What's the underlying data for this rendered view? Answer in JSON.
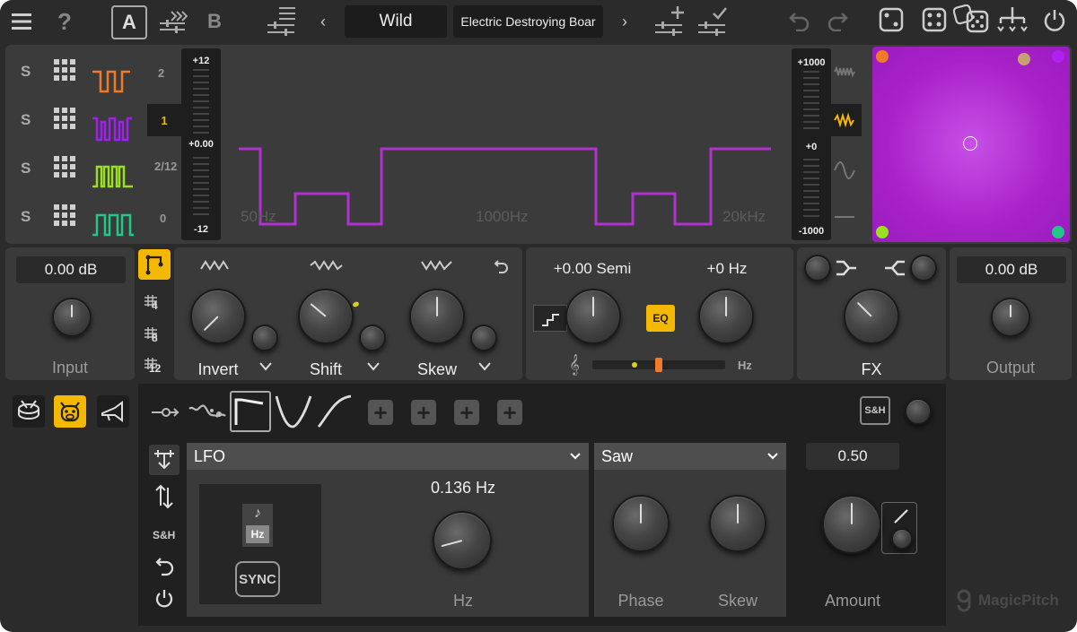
{
  "topbar": {
    "ab_a": "A",
    "ab_b": "B",
    "preset_bank": "Wild",
    "preset_name": "Electric Destroying Boar"
  },
  "osc_rows": {
    "solo_labels": [
      "S",
      "S",
      "S",
      "S"
    ],
    "waveform_colors": [
      "#f07a2a",
      "#a020f0",
      "#9ae020",
      "#22c888"
    ],
    "octave_labels": [
      "2",
      "1",
      "2/12",
      "0"
    ],
    "selected_octave": "1"
  },
  "pitch_meter": {
    "top": "+12",
    "mid": "+0.00",
    "bottom": "-12"
  },
  "display": {
    "freq_labels": [
      "50Hz",
      "1000Hz",
      "20kHz"
    ],
    "wave_color": "#b030d0"
  },
  "mod_meter": {
    "top": "+1000",
    "mid": "+0",
    "bottom": "-1000"
  },
  "xy_pad": {
    "bg": "#a822c8",
    "corner_colors": [
      "#f07a2a",
      "#c8a070",
      "#b020f0",
      "#9ae020",
      "#22c888"
    ]
  },
  "input": {
    "value": "0.00 dB",
    "label": "Input"
  },
  "routing_side": {
    "grid_labels": [
      "4",
      "8",
      "12"
    ]
  },
  "shaper": {
    "knobs": [
      "Invert",
      "Shift",
      "Skew"
    ]
  },
  "pitch": {
    "semi": "+0.00 Semi",
    "hz": "+0 Hz",
    "eq": "EQ",
    "hz_label": "Hz",
    "slider_value": 0.45
  },
  "fx": {
    "label": "FX"
  },
  "output": {
    "value": "0.00 dB",
    "label": "Output"
  },
  "mod_tabs": {
    "sh_label": "S&H"
  },
  "modulator": {
    "source": "LFO",
    "rate": "0.136 Hz",
    "rate_label": "Hz",
    "hz_tag": "Hz",
    "sync": "SYNC",
    "side_sh": "S&H",
    "shape": "Saw",
    "phase_label": "Phase",
    "skew_label": "Skew",
    "amount": "0.50",
    "amount_label": "Amount"
  },
  "brand": "MagicPitch"
}
